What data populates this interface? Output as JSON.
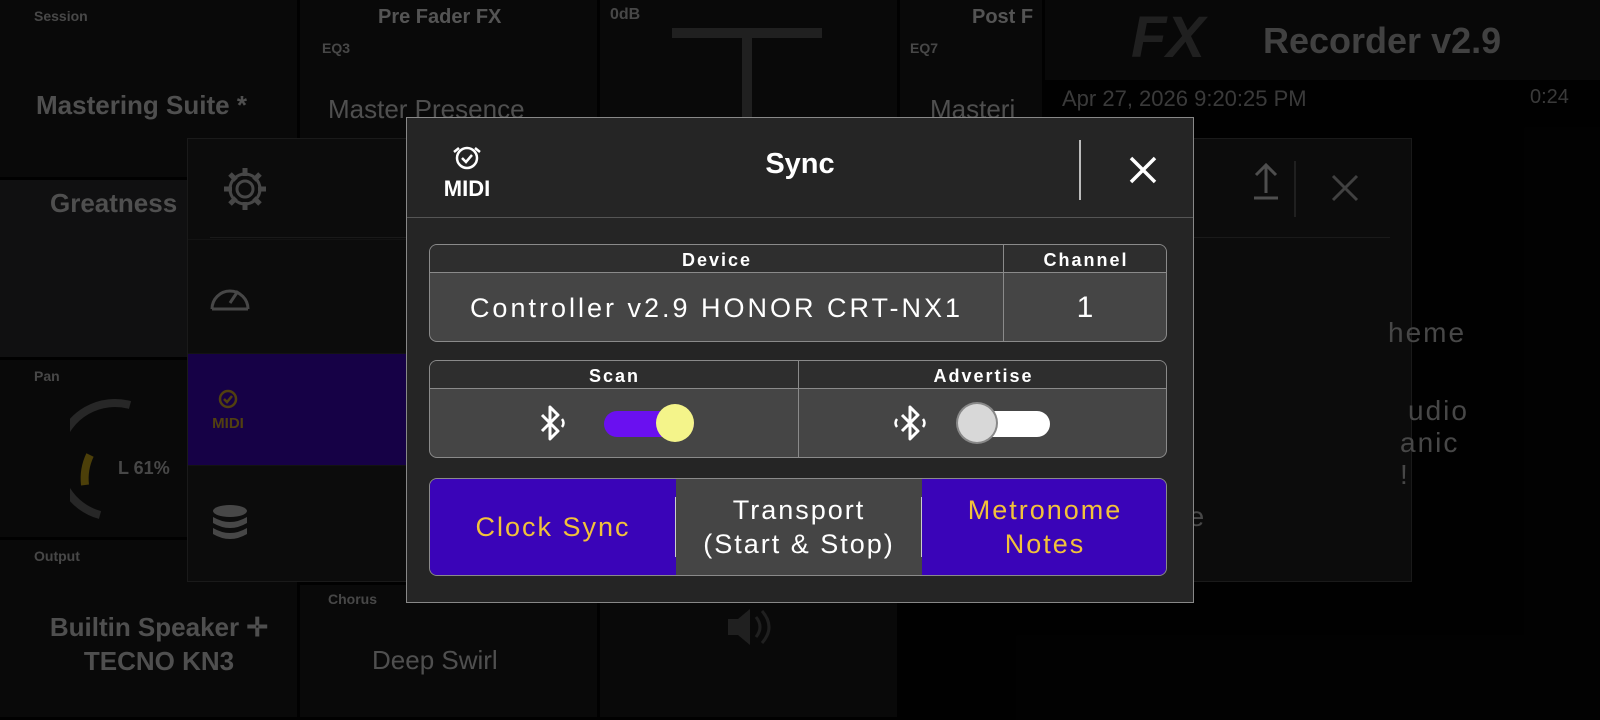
{
  "background": {
    "session_label": "Session",
    "session_name": "Mastering Suite *",
    "prefader_label": "Pre Fader FX",
    "eq_label_1": "EQ3",
    "eq_label_2": "EQ7",
    "preset_1": "Master Presence",
    "preset_2": "Masteri",
    "db_label": "0dB",
    "postfader_label": "Post F",
    "song_title": "Greatness",
    "pan_label": "Pan",
    "pan_value": "L 61%",
    "output_label": "Output",
    "output_device": "Builtin Speaker ✛ TECNO KN3",
    "chorus_label": "Chorus",
    "chorus_preset": "Deep Swirl",
    "app_name": "Recorder v2.9",
    "app_logo_text": "FX",
    "datetime": "Apr 27, 2026 9:20:25 PM",
    "elapsed": "0:24",
    "settings_items": [
      "heme",
      "e",
      "udio",
      "anic !",
      "de"
    ]
  },
  "modal": {
    "title": "Sync",
    "device_label": "Device",
    "device_value": "Controller v2.9 HONOR CRT-NX1",
    "channel_label": "Channel",
    "channel_value": "1",
    "scan_label": "Scan",
    "advertise_label": "Advertise",
    "scan_on": true,
    "advertise_on": false,
    "clock_sync_label": "Clock Sync",
    "transport_label": "Transport\n(Start & Stop)",
    "metronome_label": "Metronome\nNotes",
    "clock_sync_active": true,
    "transport_active": false,
    "metronome_active": true
  },
  "colors": {
    "accent_purple": "#3a04b8",
    "toggle_on_track": "#6a10f0",
    "toggle_on_knob": "#f4f48a",
    "active_text": "#f2c23a",
    "midi_icon_active": "#d6a82a"
  }
}
